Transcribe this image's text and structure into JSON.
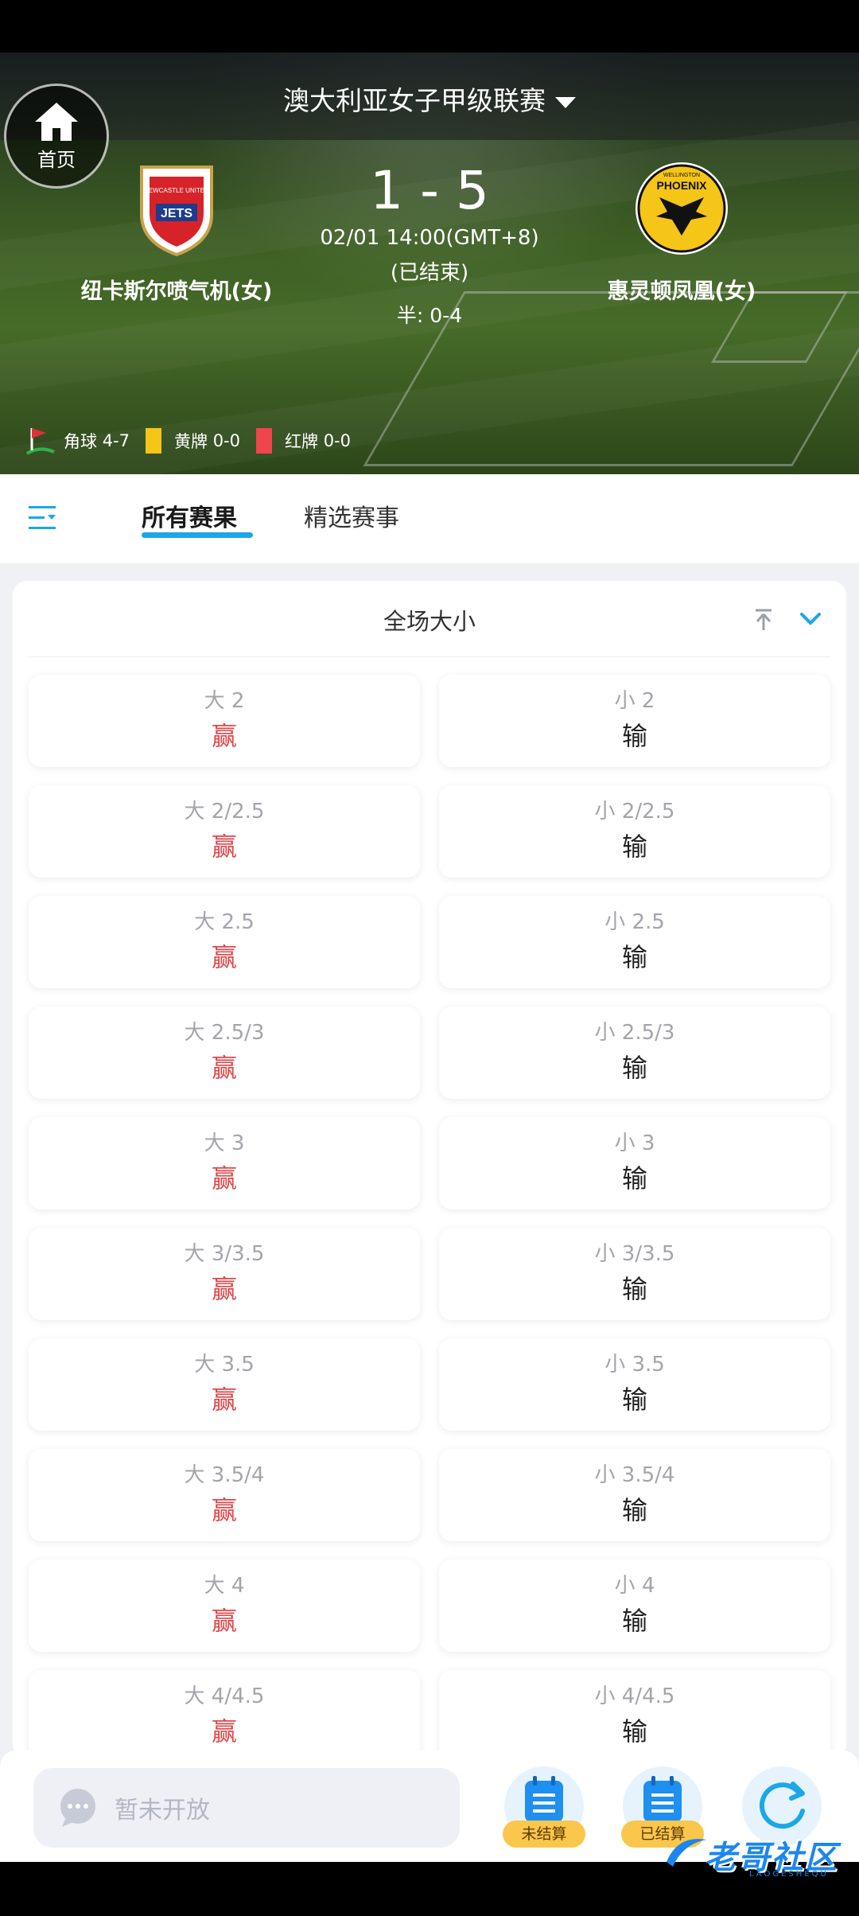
{
  "header": {
    "home_label": "首页",
    "league": "澳大利亚女子甲级联赛"
  },
  "match": {
    "home_team": "纽卡斯尔喷气机(女)",
    "away_team": "惠灵顿凤凰(女)",
    "home_logo_text": "JETS",
    "home_logo_sub": "NEWCASTLE UNITED",
    "away_logo_text": "PHOENIX",
    "away_logo_sub": "WELLINGTON",
    "score": "1 - 5",
    "datetime": "02/01 14:00(GMT+8)",
    "status": "(已结束)",
    "half_label": "半:",
    "half_score": "0-4"
  },
  "stats": {
    "corner_label": "角球",
    "corner_value": "4-7",
    "yellow_label": "黄牌",
    "yellow_value": "0-0",
    "red_label": "红牌",
    "red_value": "0-0"
  },
  "tabs": [
    {
      "label": "所有赛果"
    },
    {
      "label": "精选赛事"
    }
  ],
  "market": {
    "title": "全场大小",
    "rows": [
      {
        "over": "大 2",
        "over_result": "赢",
        "under": "小 2",
        "under_result": "输"
      },
      {
        "over": "大 2/2.5",
        "over_result": "赢",
        "under": "小 2/2.5",
        "under_result": "输"
      },
      {
        "over": "大 2.5",
        "over_result": "赢",
        "under": "小 2.5",
        "under_result": "输"
      },
      {
        "over": "大 2.5/3",
        "over_result": "赢",
        "under": "小 2.5/3",
        "under_result": "输"
      },
      {
        "over": "大 3",
        "over_result": "赢",
        "under": "小 3",
        "under_result": "输"
      },
      {
        "over": "大 3/3.5",
        "over_result": "赢",
        "under": "小 3/3.5",
        "under_result": "输"
      },
      {
        "over": "大 3.5",
        "over_result": "赢",
        "under": "小 3.5",
        "under_result": "输"
      },
      {
        "over": "大 3.5/4",
        "over_result": "赢",
        "under": "小 3.5/4",
        "under_result": "输"
      },
      {
        "over": "大 4",
        "over_result": "赢",
        "under": "小 4",
        "under_result": "输"
      },
      {
        "over": "大 4/4.5",
        "over_result": "赢",
        "under": "小 4/4.5",
        "under_result": "输"
      }
    ]
  },
  "bottom": {
    "chat_placeholder": "暂未开放",
    "unsettled_label": "未结算",
    "settled_label": "已结算"
  },
  "watermark": {
    "text": "老哥社区",
    "sub": "LAOGESHEQU"
  },
  "colors": {
    "accent": "#1ba7e8",
    "win": "#e0464a",
    "lose": "#222222",
    "tag": "#fbc64c",
    "yellow_card": "#f5c518",
    "red_card": "#f0454d"
  }
}
